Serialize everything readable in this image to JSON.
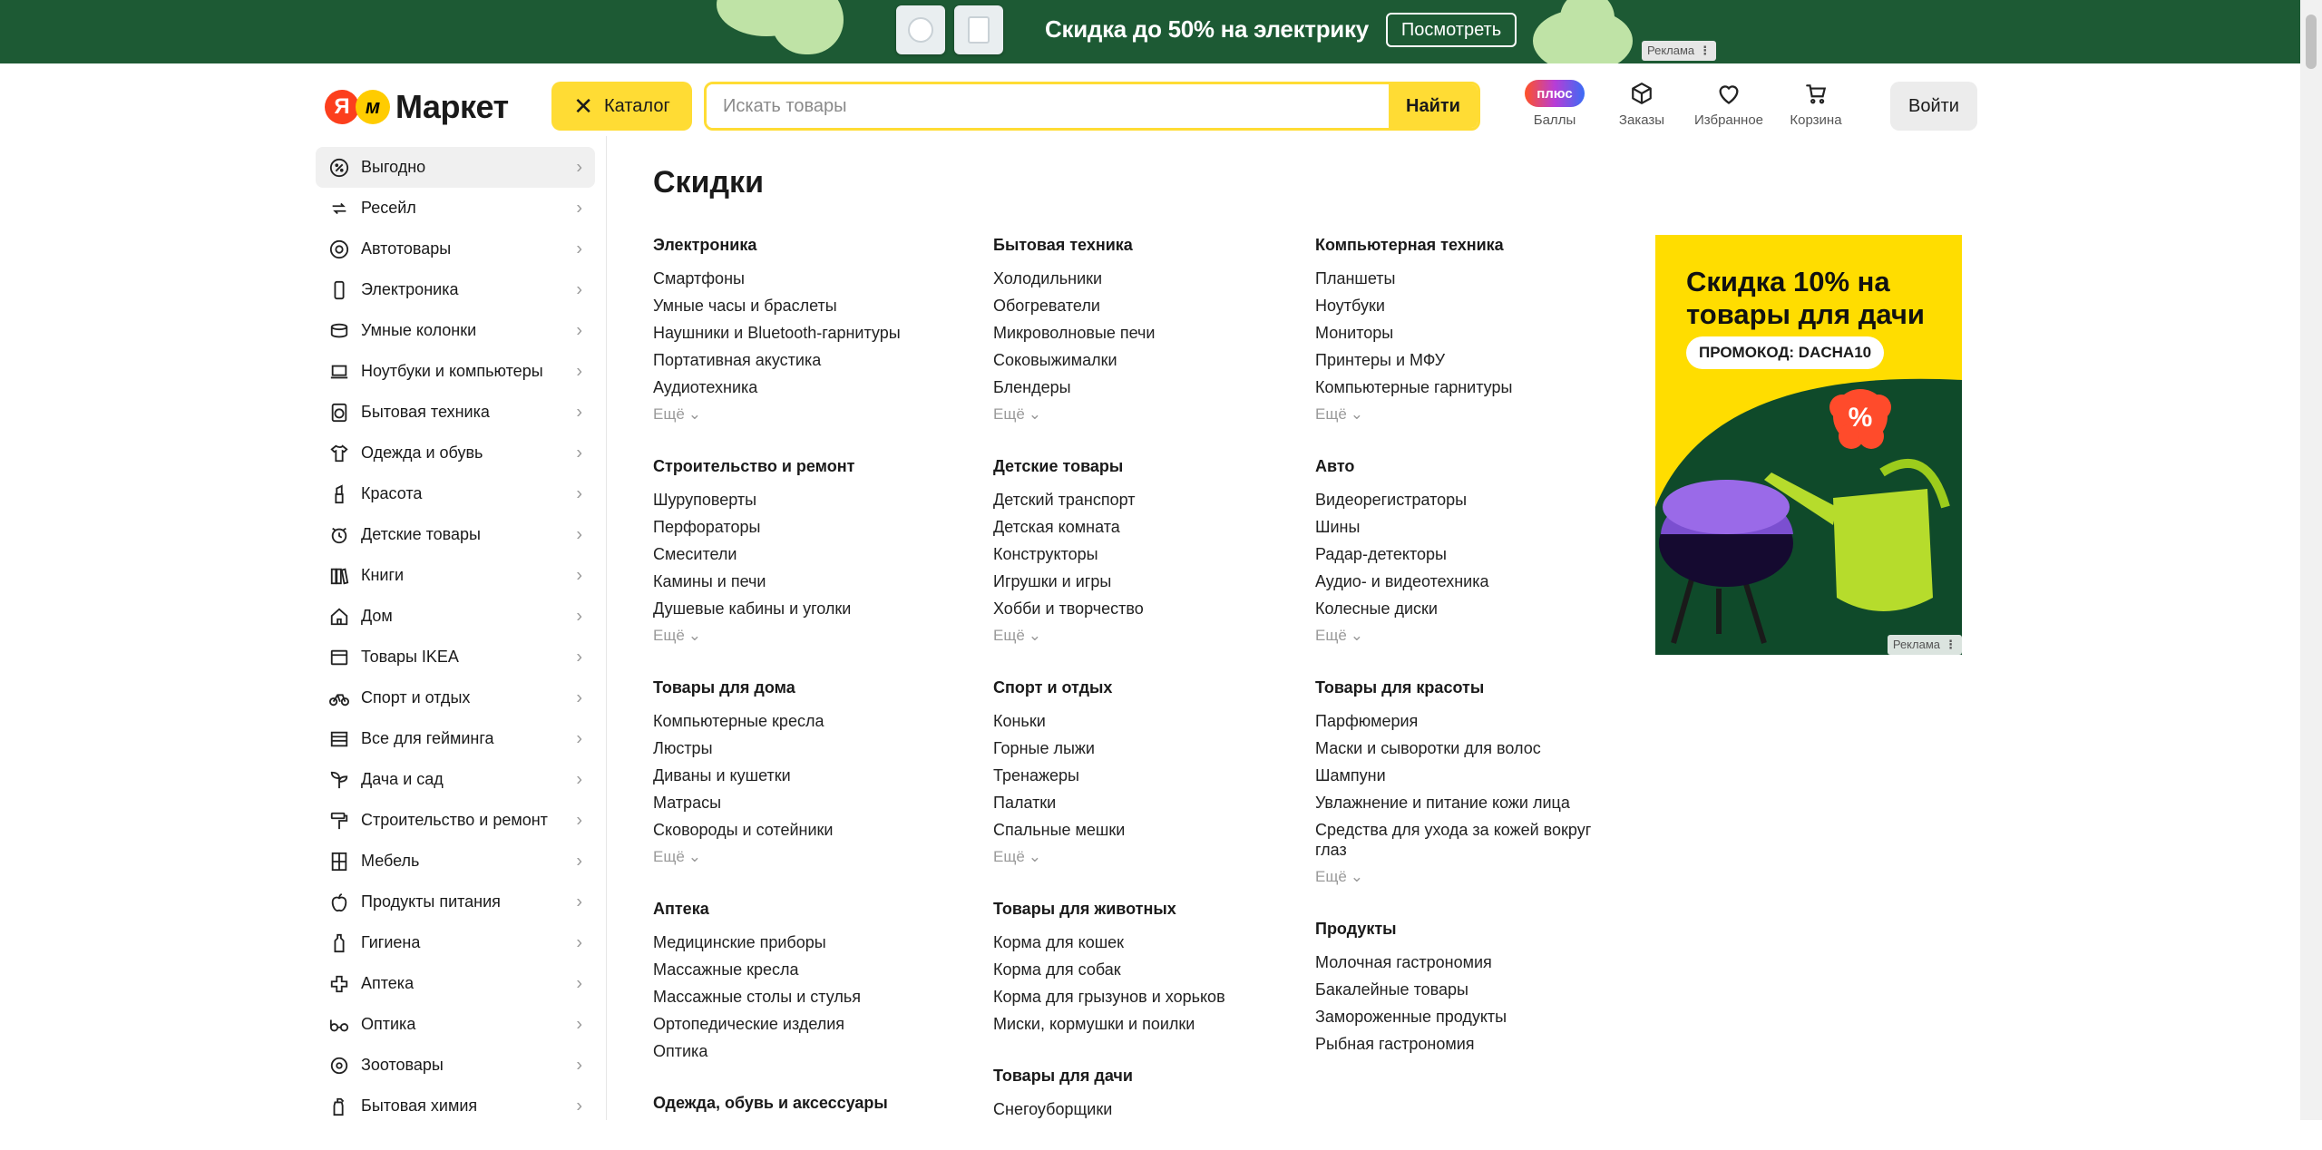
{
  "banner": {
    "promo_text": "Скидка до 50% на электрику",
    "button_label": "Посмотреть",
    "ad_label": "Реклама",
    "colors": {
      "background": "#1d5a34",
      "blobs": "#bfe3a6"
    }
  },
  "header": {
    "logo_text": "Маркет",
    "logo_mark": "Я",
    "catalog_label": "Каталог",
    "search_placeholder": "Искать товары",
    "search_button": "Найти",
    "nav": [
      {
        "label": "Баллы",
        "badge": "плюс",
        "icon": "plus-badge"
      },
      {
        "label": "Заказы",
        "icon": "box-icon"
      },
      {
        "label": "Избранное",
        "icon": "heart-icon"
      },
      {
        "label": "Корзина",
        "icon": "cart-icon"
      }
    ],
    "login_label": "Войти",
    "colors": {
      "accent": "#ffdc34"
    }
  },
  "sidebar": {
    "items": [
      {
        "label": "Выгодно",
        "icon": "percent-icon",
        "active": true
      },
      {
        "label": "Ресейл",
        "icon": "resale-icon"
      },
      {
        "label": "Автотовары",
        "icon": "wheel-icon"
      },
      {
        "label": "Электроника",
        "icon": "phone-icon"
      },
      {
        "label": "Умные колонки",
        "icon": "speaker-icon"
      },
      {
        "label": "Ноутбуки и компьютеры",
        "icon": "laptop-icon"
      },
      {
        "label": "Бытовая техника",
        "icon": "washer-icon"
      },
      {
        "label": "Одежда и обувь",
        "icon": "shirt-icon"
      },
      {
        "label": "Красота",
        "icon": "lipstick-icon"
      },
      {
        "label": "Детские товары",
        "icon": "clock-toy-icon"
      },
      {
        "label": "Книги",
        "icon": "books-icon"
      },
      {
        "label": "Дом",
        "icon": "home-icon"
      },
      {
        "label": "Товары IKEA",
        "icon": "ikea-icon"
      },
      {
        "label": "Спорт и отдых",
        "icon": "bike-icon"
      },
      {
        "label": "Все для гейминга",
        "icon": "gamepad-icon"
      },
      {
        "label": "Дача и сад",
        "icon": "plant-icon"
      },
      {
        "label": "Строительство и ремонт",
        "icon": "roller-icon"
      },
      {
        "label": "Мебель",
        "icon": "shelf-icon"
      },
      {
        "label": "Продукты питания",
        "icon": "apple-icon"
      },
      {
        "label": "Гигиена",
        "icon": "bottle-icon"
      },
      {
        "label": "Аптека",
        "icon": "cross-icon"
      },
      {
        "label": "Оптика",
        "icon": "glasses-icon"
      },
      {
        "label": "Зоотовары",
        "icon": "paw-icon"
      },
      {
        "label": "Бытовая химия",
        "icon": "spray-icon"
      }
    ]
  },
  "main": {
    "title": "Скидки",
    "more_label": "Ещё",
    "columns": [
      [
        {
          "title": "Электроника",
          "links": [
            "Смартфоны",
            "Умные часы и браслеты",
            "Наушники и Bluetooth-гарнитуры",
            "Портативная акустика",
            "Аудиотехника"
          ],
          "more": true
        },
        {
          "title": "Строительство и ремонт",
          "links": [
            "Шуруповерты",
            "Перфораторы",
            "Смесители",
            "Камины и печи",
            "Душевые кабины и уголки"
          ],
          "more": true
        },
        {
          "title": "Товары для дома",
          "links": [
            "Компьютерные кресла",
            "Люстры",
            "Диваны и кушетки",
            "Матрасы",
            "Сковороды и сотейники"
          ],
          "more": true
        },
        {
          "title": "Аптека",
          "links": [
            "Медицинские приборы",
            "Массажные кресла",
            "Массажные столы и стулья",
            "Ортопедические изделия",
            "Оптика"
          ],
          "more": false
        },
        {
          "title": "Одежда, обувь и аксессуары",
          "links": [],
          "more": false
        }
      ],
      [
        {
          "title": "Бытовая техника",
          "links": [
            "Холодильники",
            "Обогреватели",
            "Микроволновые печи",
            "Соковыжималки",
            "Блендеры"
          ],
          "more": true
        },
        {
          "title": "Детские товары",
          "links": [
            "Детский транспорт",
            "Детская комната",
            "Конструкторы",
            "Игрушки и игры",
            "Хобби и творчество"
          ],
          "more": true
        },
        {
          "title": "Спорт и отдых",
          "links": [
            "Коньки",
            "Горные лыжи",
            "Тренажеры",
            "Палатки",
            "Спальные мешки"
          ],
          "more": true
        },
        {
          "title": "Товары для животных",
          "links": [
            "Корма для кошек",
            "Корма для собак",
            "Корма для грызунов и хорьков",
            "Миски, кормушки и поилки"
          ],
          "more": false
        },
        {
          "title": "Товары для дачи",
          "links": [
            "Снегоуборщики"
          ],
          "more": false
        }
      ],
      [
        {
          "title": "Компьютерная техника",
          "links": [
            "Планшеты",
            "Ноутбуки",
            "Мониторы",
            "Принтеры и МФУ",
            "Компьютерные гарнитуры"
          ],
          "more": true
        },
        {
          "title": "Авто",
          "links": [
            "Видеорегистраторы",
            "Шины",
            "Радар-детекторы",
            "Аудио- и видеотехника",
            "Колесные диски"
          ],
          "more": true
        },
        {
          "title": "Товары для красоты",
          "links": [
            "Парфюмерия",
            "Маски и сыворотки для волос",
            "Шампуни",
            "Увлажнение и питание кожи лица",
            "Средства для ухода за кожей вокруг глаз"
          ],
          "more": true
        },
        {
          "title": "Продукты",
          "links": [
            "Молочная гастрономия",
            "Бакалейные товары",
            "Замороженные продукты",
            "Рыбная гастрономия"
          ],
          "more": false
        }
      ]
    ]
  },
  "side_ad": {
    "headline": "Скидка 10% на товары для дачи",
    "promo_code": "ПРОМОКОД: DACHA10",
    "badge": "%",
    "ad_label": "Реклама",
    "colors": {
      "background": "#ffdd00",
      "dark": "#0f4a2a",
      "badge": "#ff4b2b"
    }
  }
}
